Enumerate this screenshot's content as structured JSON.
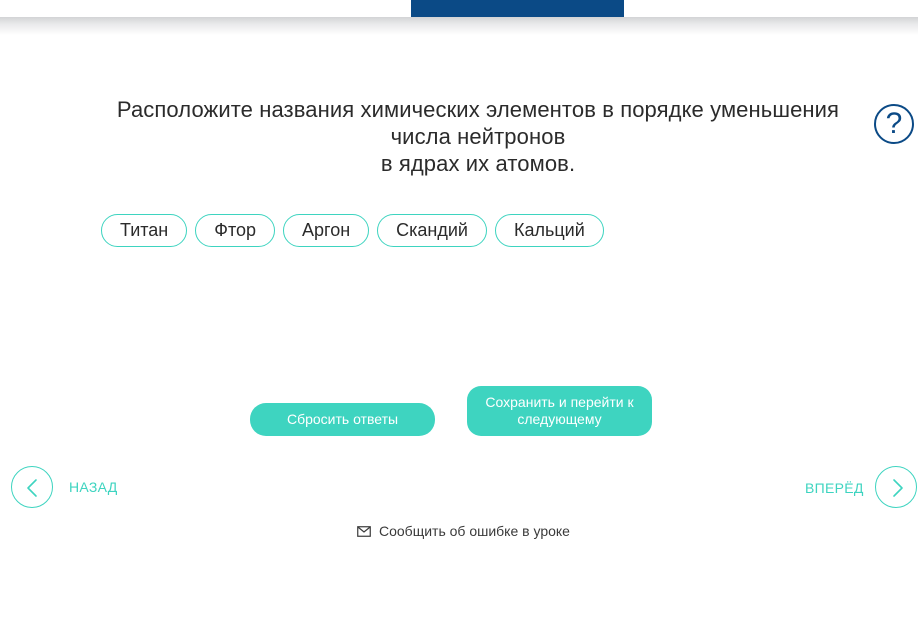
{
  "colors": {
    "accent": "#3ed4c0",
    "brand": "#0b4a86",
    "text": "#2b2b2b"
  },
  "question": {
    "lines": [
      "Расположите названия химических элементов в порядке уменьшения",
      "числа нейтронов",
      "в ядрах их атомов."
    ]
  },
  "help": {
    "icon": "help-icon",
    "glyph": "?"
  },
  "chips": [
    "Титан",
    "Фтор",
    "Аргон",
    "Скандий",
    "Кальций"
  ],
  "actions": {
    "reset_label": "Сбросить ответы",
    "save_label": "Сохранить и перейти к следующему"
  },
  "nav": {
    "prev_label": "НАЗАД",
    "next_label": "ВПЕРЁД"
  },
  "report": {
    "icon": "mail-icon",
    "label": "Сообщить об ошибке в уроке"
  }
}
